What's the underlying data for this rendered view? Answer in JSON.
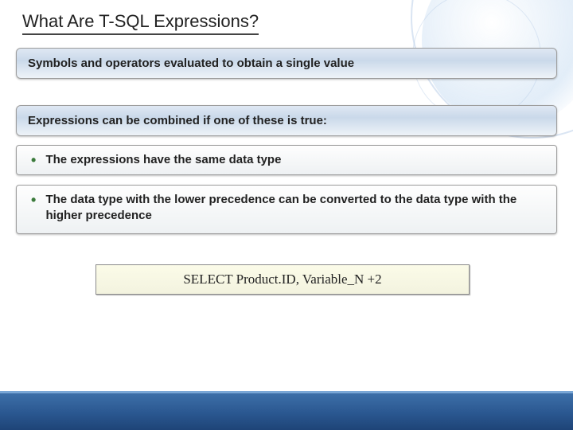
{
  "title": "What Are T-SQL Expressions?",
  "definition": "Symbols and operators evaluated to obtain a single value",
  "subheading": "Expressions can be combined if one of these is true:",
  "bullets": [
    "The expressions have the same data type",
    "The data type with the lower precedence can be converted to the data type with the higher precedence"
  ],
  "code": "SELECT Product.ID, Variable_N +2"
}
